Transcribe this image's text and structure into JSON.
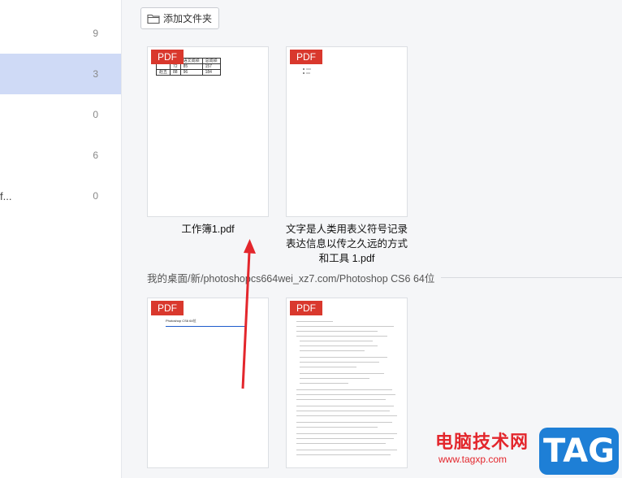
{
  "sidebar": {
    "items": [
      {
        "label": "",
        "count": "9",
        "selected": false
      },
      {
        "label": "",
        "count": "3",
        "selected": true
      },
      {
        "label": "",
        "count": "0",
        "selected": false
      },
      {
        "label": "",
        "count": "6",
        "selected": false
      },
      {
        "label": "f...",
        "count": "0",
        "selected": false
      }
    ]
  },
  "toolbar": {
    "add_folder_label": "添加文件夹",
    "add_folder_icon": "folder-icon"
  },
  "groups": [
    {
      "path": "",
      "files": [
        {
          "name": "工作簿1.pdf",
          "badge": "PDF",
          "preview": "table",
          "table": [
            [
              "",
              "",
              "语文成绩",
              "总成绩"
            ],
            [
              "",
              "72",
              "85",
              "157"
            ],
            [
              "赵五",
              "88",
              "96",
              "184"
            ]
          ]
        },
        {
          "name": "文字是人类用表义符号记录表达信息以传之久远的方式和工具 1.pdf",
          "badge": "PDF",
          "preview": "bullets"
        }
      ]
    },
    {
      "path": "我的桌面/新/photoshopcs664wei_xz7.com/Photoshop CS6 64位",
      "files": [
        {
          "name": "",
          "badge": "PDF",
          "preview": "link",
          "preview_title": "Photoshop CS6 64位"
        },
        {
          "name": "",
          "badge": "PDF",
          "preview": "text"
        }
      ]
    }
  ],
  "watermark": {
    "text_cn": "电脑技术网",
    "url": "www.tagxp.com",
    "tag": "TAG"
  },
  "colors": {
    "badge": "#d9382d",
    "selected_row": "#cfdaf6",
    "arrow": "#e3262c"
  }
}
